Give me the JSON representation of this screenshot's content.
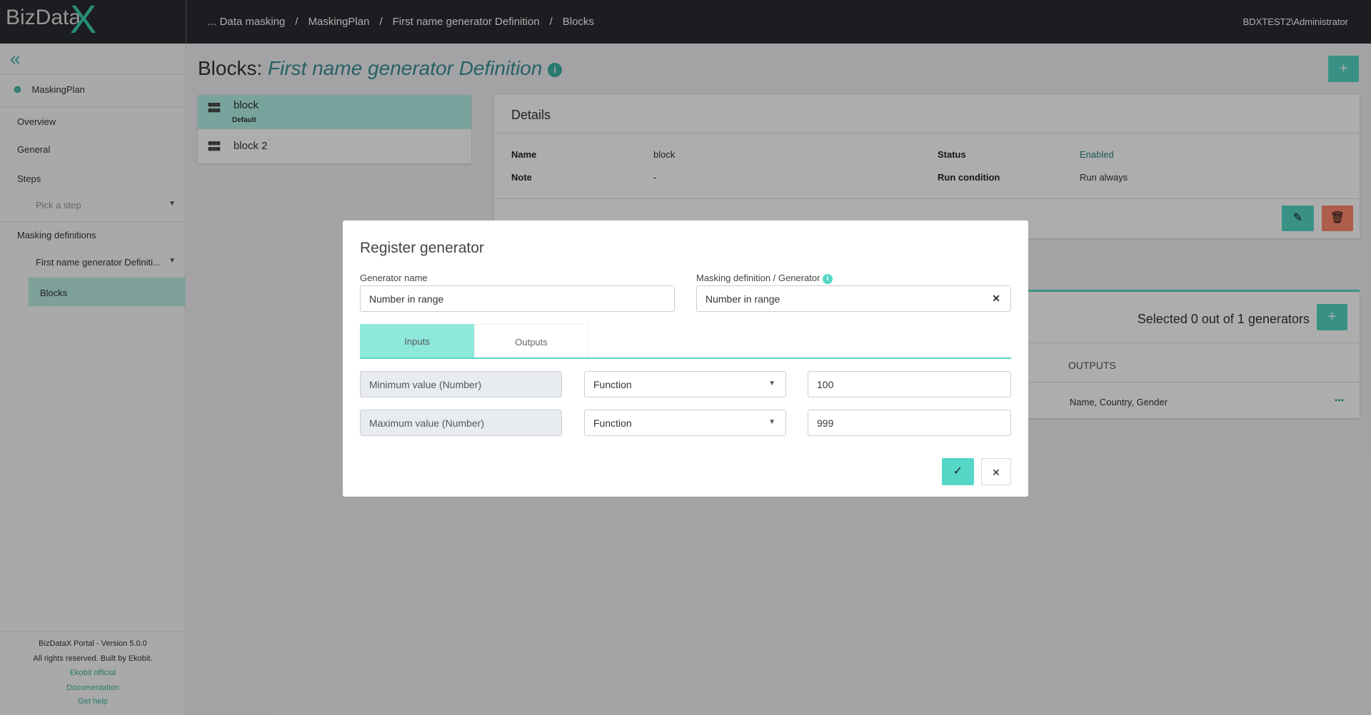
{
  "header": {
    "logo": "BizData",
    "logo_x": "X",
    "breadcrumb": [
      "... Data masking",
      "MaskingPlan",
      "First name generator Definition",
      "Blocks"
    ],
    "separator": "/",
    "user": "BDXTEST2\\Administrator"
  },
  "sidebar": {
    "collapse_icon": "«",
    "plan": "MaskingPlan",
    "items": {
      "overview": "Overview",
      "general": "General",
      "steps": "Steps",
      "pick_step": "Pick a step",
      "masking_definitions": "Masking definitions",
      "definition": "First name generator Definiti...",
      "blocks": "Blocks"
    },
    "footer": {
      "version": "BizDataX Portal - Version 5.0.0",
      "rights": "All rights reserved. Built by Ekobit.",
      "links": [
        "Ekobit official",
        "Documentation",
        "Get help"
      ]
    }
  },
  "page": {
    "title_prefix": "Blocks:",
    "title_name": "First name generator Definition",
    "add_label": "+"
  },
  "blocks": [
    {
      "name": "block",
      "badge": "Default",
      "selected": true
    },
    {
      "name": "block 2"
    }
  ],
  "details": {
    "title": "Details",
    "name_label": "Name",
    "name": "block",
    "note_label": "Note",
    "note": "-",
    "status_label": "Status",
    "status": "Enabled",
    "run_label": "Run condition",
    "run": "Run always"
  },
  "generators": {
    "summary": "Selected 0 out of 1 generators",
    "outputs_header": "OUTPUTS",
    "row_outputs": "Name, Country, Gender",
    "more": "•••"
  },
  "modal": {
    "title": "Register generator",
    "gen_name_label": "Generator name",
    "gen_name": "Number in range",
    "def_label": "Masking definition / Generator",
    "def_value": "Number in range",
    "clear": "✕",
    "tabs": [
      "Inputs",
      "Outputs"
    ],
    "active_tab": "Inputs",
    "rows": [
      {
        "param": "Minimum value (Number)",
        "type": "Function",
        "value": "100"
      },
      {
        "param": "Maximum value (Number)",
        "type": "Function",
        "value": "999"
      }
    ],
    "confirm": "✓",
    "cancel": "✕"
  },
  "colors": {
    "accent": "#55d6c6",
    "danger": "#ff8a6d",
    "header": "#282b30"
  }
}
